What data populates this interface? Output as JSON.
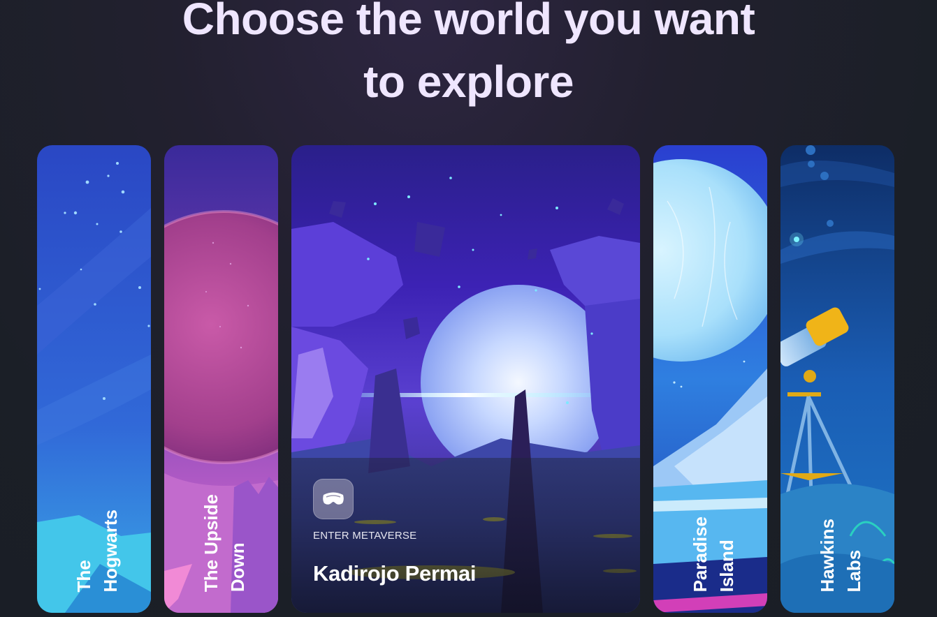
{
  "headline": {
    "line1": "Choose the world you want",
    "line2": "to explore"
  },
  "worlds": [
    {
      "label_line1": "The",
      "label_line2": "Hogwarts"
    },
    {
      "label_line1": "The Upside",
      "label_line2": "Down"
    },
    {
      "enter_label": "ENTER METAVERSE",
      "title": "Kadirojo Permai",
      "icon": "vr-headset-icon"
    },
    {
      "label_line1": "Paradise",
      "label_line2": "Island"
    },
    {
      "label_line1": "Hawkins",
      "label_line2": "Labs"
    }
  ],
  "colors": {
    "headline": "#efe6ff",
    "background": "#1b1f27",
    "accent_purple": "#5b2bd8",
    "accent_blue": "#2f6fe0"
  }
}
